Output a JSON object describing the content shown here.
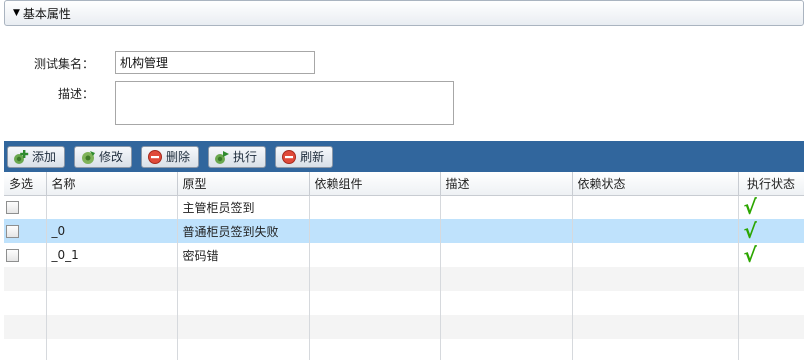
{
  "panel": {
    "title": "基本属性"
  },
  "form": {
    "name_label": "测试集名：",
    "name_value": "机构管理",
    "desc_label": "描述："
  },
  "toolbar": {
    "add": "添加",
    "edit": "修改",
    "delete": "删除",
    "run": "执行",
    "refresh": "刷新"
  },
  "table": {
    "headers": {
      "multi": "多选",
      "name": "名称",
      "prototype": "原型",
      "dependency": "依赖组件",
      "description": "描述",
      "dep_status": "依赖状态",
      "exec_status": "执行状态"
    },
    "rows": [
      {
        "name": "",
        "prototype": "主管柜员签到",
        "dependency": "",
        "description": "",
        "dep_status": "",
        "exec_status": "√"
      },
      {
        "name": "_0",
        "prototype": "普通柜员签到失败",
        "dependency": "",
        "description": "",
        "dep_status": "",
        "exec_status": "√"
      },
      {
        "name": "_0_1",
        "prototype": "密码错",
        "dependency": "",
        "description": "",
        "dep_status": "",
        "exec_status": "√"
      }
    ]
  },
  "colors": {
    "toolbar_bg": "#31669d",
    "selected_row": "#bfe2fc",
    "check_green": "#2ca600"
  }
}
